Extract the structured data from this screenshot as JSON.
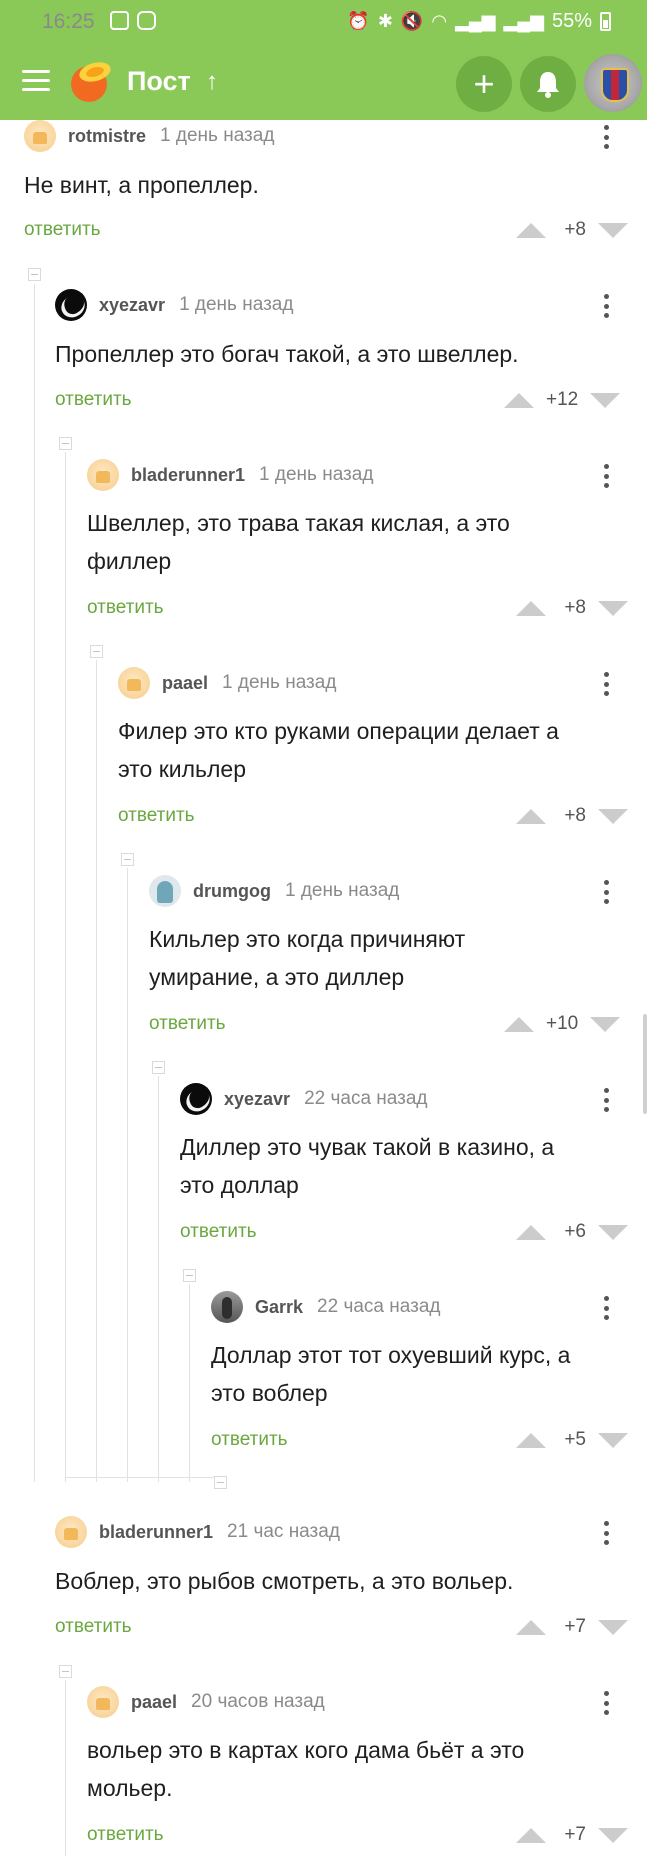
{
  "status_bar": {
    "time": "16:25",
    "battery": "55%",
    "left_icons": [
      "gallery-icon",
      "instagram-icon"
    ],
    "right_icons": [
      "alarm-icon",
      "bluetooth-icon",
      "mute-icon",
      "wifi-icon",
      "signal-icon",
      "signal-icon",
      "battery-icon"
    ]
  },
  "app_bar": {
    "title": "Пост",
    "up_symbol": "↑",
    "plus_symbol": "+",
    "bg_color": "#8ac858",
    "button_color": "#6eae43"
  },
  "theme": {
    "reply_color": "#6aa83f",
    "vote_arrow_color": "#cccccc"
  },
  "comments": [
    {
      "author": "rotmistre",
      "time": "1 день назад",
      "text": "Не винт, а пропеллер.",
      "reply": "ответить",
      "rating": "+8",
      "avatar": "default-avatar"
    },
    {
      "author": "xyezavr",
      "time": "1 день назад",
      "text": "Пропеллер это богач такой, а это швеллер.",
      "reply": "ответить",
      "rating": "+12",
      "avatar": "bird-avatar"
    },
    {
      "author": "bladerunner1",
      "time": "1 день назад",
      "text": "Швеллер, это трава такая кислая, а это\nфиллер",
      "reply": "ответить",
      "rating": "+8",
      "avatar": "default-avatar"
    },
    {
      "author": "paael",
      "time": "1 день назад",
      "text": "Филер это кто руками операции делает а\nэто кильлер",
      "reply": "ответить",
      "rating": "+8",
      "avatar": "default-avatar"
    },
    {
      "author": "drumgog",
      "time": "1 день назад",
      "text": "Кильлер это когда причиняют\nумирание, а это диллер",
      "reply": "ответить",
      "rating": "+10",
      "avatar": "ghost-avatar"
    },
    {
      "author": "xyezavr",
      "time": "22 часа назад",
      "text": "Диллер это чувак такой в казино, а\nэто доллар",
      "reply": "ответить",
      "rating": "+6",
      "avatar": "bird-avatar"
    },
    {
      "author": "Garrk",
      "time": "22 часа назад",
      "text": "Доллар этот тот охуевший курс, а\nэто воблер",
      "reply": "ответить",
      "rating": "+5",
      "avatar": "photo-avatar"
    },
    {
      "author": "bladerunner1",
      "time": "21 час назад",
      "text": "Воблер, это рыбов смотреть, а это вольер.",
      "reply": "ответить",
      "rating": "+7",
      "avatar": "default-avatar"
    },
    {
      "author": "paael",
      "time": "20 часов назад",
      "text": "вольер это в картах кого дама бьёт а это\nмольер.",
      "reply": "ответить",
      "rating": "+7",
      "avatar": "default-avatar"
    }
  ]
}
